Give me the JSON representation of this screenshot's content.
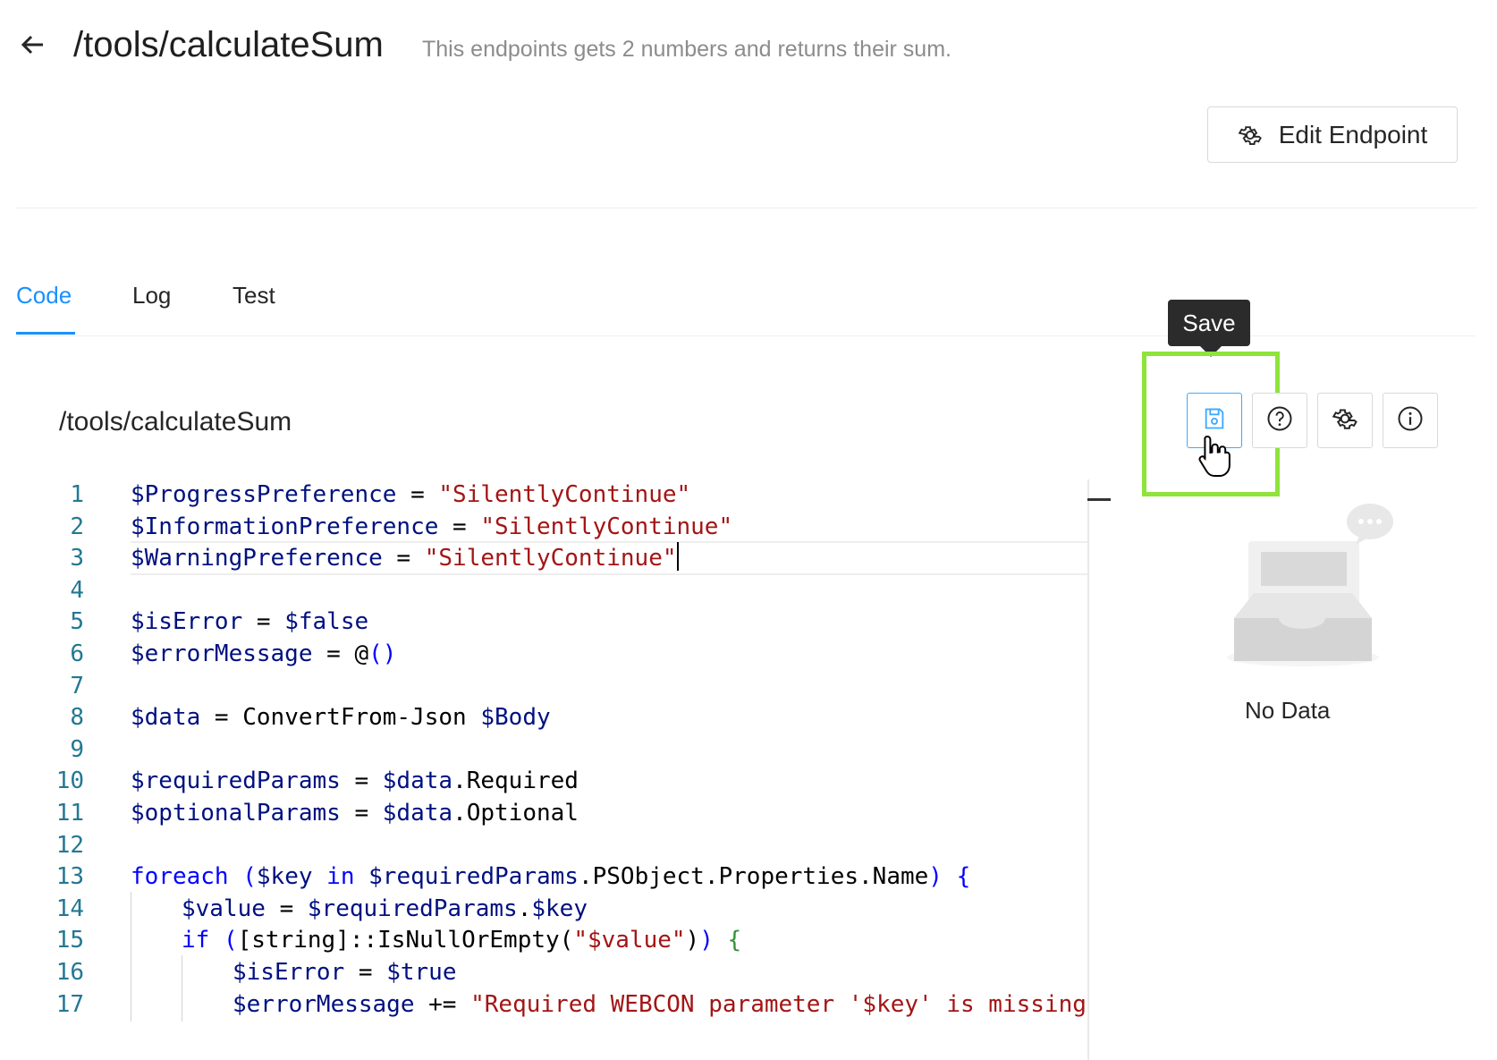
{
  "header": {
    "title": "/tools/calculateSum",
    "subtitle": "This endpoints gets 2 numbers and returns their sum.",
    "edit_label": "Edit Endpoint"
  },
  "tabs": [
    {
      "label": "Code",
      "active": true
    },
    {
      "label": "Log",
      "active": false
    },
    {
      "label": "Test",
      "active": false
    }
  ],
  "code_panel": {
    "title": "/tools/calculateSum",
    "lines": [
      {
        "n": "1",
        "indent": 0,
        "tokens": [
          [
            "v",
            "$ProgressPreference"
          ],
          [
            "p",
            " = "
          ],
          [
            "s",
            "\"SilentlyContinue\""
          ]
        ]
      },
      {
        "n": "2",
        "indent": 0,
        "tokens": [
          [
            "v",
            "$InformationPreference"
          ],
          [
            "p",
            " = "
          ],
          [
            "s",
            "\"SilentlyContinue\""
          ]
        ]
      },
      {
        "n": "3",
        "indent": 0,
        "current": true,
        "tokens": [
          [
            "v",
            "$WarningPreference"
          ],
          [
            "p",
            " = "
          ],
          [
            "s",
            "\"SilentlyContinue\""
          ]
        ]
      },
      {
        "n": "4",
        "indent": 0,
        "tokens": []
      },
      {
        "n": "5",
        "indent": 0,
        "tokens": [
          [
            "v",
            "$isError"
          ],
          [
            "p",
            " = "
          ],
          [
            "v",
            "$false"
          ]
        ]
      },
      {
        "n": "6",
        "indent": 0,
        "tokens": [
          [
            "v",
            "$errorMessage"
          ],
          [
            "p",
            " = "
          ],
          [
            "p",
            "@"
          ],
          [
            "b",
            "()"
          ]
        ]
      },
      {
        "n": "7",
        "indent": 0,
        "tokens": []
      },
      {
        "n": "8",
        "indent": 0,
        "tokens": [
          [
            "v",
            "$data"
          ],
          [
            "p",
            " = ConvertFrom-Json "
          ],
          [
            "v",
            "$Body"
          ]
        ]
      },
      {
        "n": "9",
        "indent": 0,
        "tokens": []
      },
      {
        "n": "10",
        "indent": 0,
        "tokens": [
          [
            "v",
            "$requiredParams"
          ],
          [
            "p",
            " = "
          ],
          [
            "v",
            "$data"
          ],
          [
            "p",
            ".Required"
          ]
        ]
      },
      {
        "n": "11",
        "indent": 0,
        "tokens": [
          [
            "v",
            "$optionalParams"
          ],
          [
            "p",
            " = "
          ],
          [
            "v",
            "$data"
          ],
          [
            "p",
            ".Optional"
          ]
        ]
      },
      {
        "n": "12",
        "indent": 0,
        "tokens": []
      },
      {
        "n": "13",
        "indent": 0,
        "tokens": [
          [
            "k",
            "foreach"
          ],
          [
            "p",
            " "
          ],
          [
            "b",
            "("
          ],
          [
            "v",
            "$key"
          ],
          [
            "p",
            " "
          ],
          [
            "k",
            "in"
          ],
          [
            "p",
            " "
          ],
          [
            "v",
            "$requiredParams"
          ],
          [
            "p",
            ".PSObject.Properties.Name"
          ],
          [
            "b",
            ")"
          ],
          [
            "p",
            " "
          ],
          [
            "b",
            "{"
          ]
        ]
      },
      {
        "n": "14",
        "indent": 1,
        "tokens": [
          [
            "v",
            "$value"
          ],
          [
            "p",
            " = "
          ],
          [
            "v",
            "$requiredParams"
          ],
          [
            "p",
            "."
          ],
          [
            "v",
            "$key"
          ]
        ]
      },
      {
        "n": "15",
        "indent": 1,
        "tokens": [
          [
            "k",
            "if"
          ],
          [
            "p",
            " "
          ],
          [
            "b",
            "("
          ],
          [
            "p",
            "[string]::IsNullOrEmpty("
          ],
          [
            "s",
            "\"$value\""
          ],
          [
            "p",
            ")"
          ],
          [
            "b",
            ")"
          ],
          [
            "p",
            " "
          ],
          [
            "g",
            "{"
          ]
        ]
      },
      {
        "n": "16",
        "indent": 2,
        "tokens": [
          [
            "v",
            "$isError"
          ],
          [
            "p",
            " = "
          ],
          [
            "v",
            "$true"
          ]
        ]
      },
      {
        "n": "17",
        "indent": 2,
        "tokens": [
          [
            "v",
            "$errorMessage"
          ],
          [
            "p",
            " += "
          ],
          [
            "s",
            "\"Required WEBCON parameter '$key' is missing"
          ]
        ]
      }
    ]
  },
  "toolbar": {
    "tooltip": "Save",
    "buttons": [
      "save-icon",
      "help-icon",
      "gear-icon",
      "info-icon"
    ]
  },
  "empty_state": {
    "text": "No Data"
  },
  "colors": {
    "accent": "#1890ff",
    "highlight": "#8ee43a",
    "variable": "#001080",
    "string": "#a31515",
    "keyword": "#0000ff",
    "bracket": "#319331",
    "line_number": "#237893"
  }
}
